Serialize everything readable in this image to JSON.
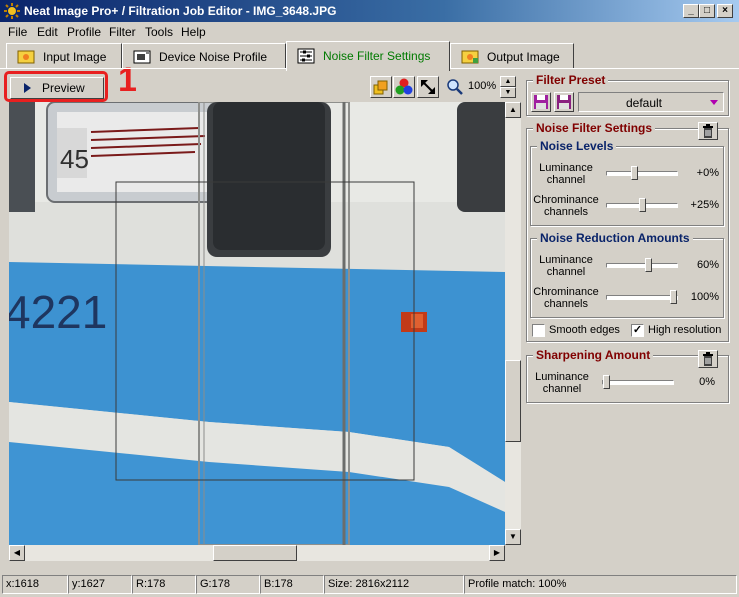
{
  "window": {
    "title": "Neat Image Pro+ / Filtration Job Editor - IMG_3648.JPG",
    "controls": [
      "minimize",
      "maximize",
      "close"
    ]
  },
  "menu": [
    "File",
    "Edit",
    "Profile",
    "Filter",
    "Tools",
    "Help"
  ],
  "tabs": [
    {
      "label": "Input Image",
      "icon": "image-icon",
      "active": false
    },
    {
      "label": "Device Noise Profile",
      "icon": "device-profile-icon",
      "active": false
    },
    {
      "label": "Noise Filter Settings",
      "icon": "filter-settings-icon",
      "active": true
    },
    {
      "label": "Output Image",
      "icon": "output-image-icon",
      "active": false
    }
  ],
  "toolbar": {
    "preview_label": "Preview",
    "zoom_value": "100%"
  },
  "annotation": {
    "number": "1",
    "color": "#e82020"
  },
  "filter_preset": {
    "title": "Filter Preset",
    "selected": "default"
  },
  "noise_filter_settings": {
    "title": "Noise Filter Settings",
    "noise_levels": {
      "title": "Noise Levels",
      "rows": [
        {
          "label": "Luminance channel",
          "value": "+0%",
          "slider_pos": 0.38
        },
        {
          "label": "Chrominance channels",
          "value": "+25%",
          "slider_pos": 0.5
        }
      ]
    },
    "noise_reduction": {
      "title": "Noise Reduction Amounts",
      "rows": [
        {
          "label": "Luminance channel",
          "value": "60%",
          "slider_pos": 0.6
        },
        {
          "label": "Chrominance channels",
          "value": "100%",
          "slider_pos": 1.0
        }
      ]
    },
    "smooth_edges": {
      "label": "Smooth edges",
      "checked": false
    },
    "high_resolution": {
      "label": "High resolution",
      "checked": true
    }
  },
  "sharpening": {
    "title": "Sharpening Amount",
    "rows": [
      {
        "label": "Luminance channel",
        "value": "0%",
        "slider_pos": 0.0
      }
    ]
  },
  "status": {
    "x": "x:1618",
    "y": "y:1627",
    "r": "R:178",
    "g": "G:178",
    "b": "B:178",
    "size": "Size: 2816x2112",
    "profile_match": "Profile match: 100%"
  },
  "image_text": {
    "route_number": "45",
    "car_number": "4221"
  },
  "colors": {
    "title_bar": "#0a246a",
    "panel_title": "#800000",
    "group_title": "#0a246a",
    "active_tab": "#007a00",
    "tram_blue": "#3d92d1",
    "tram_white": "#e6e7e3"
  }
}
